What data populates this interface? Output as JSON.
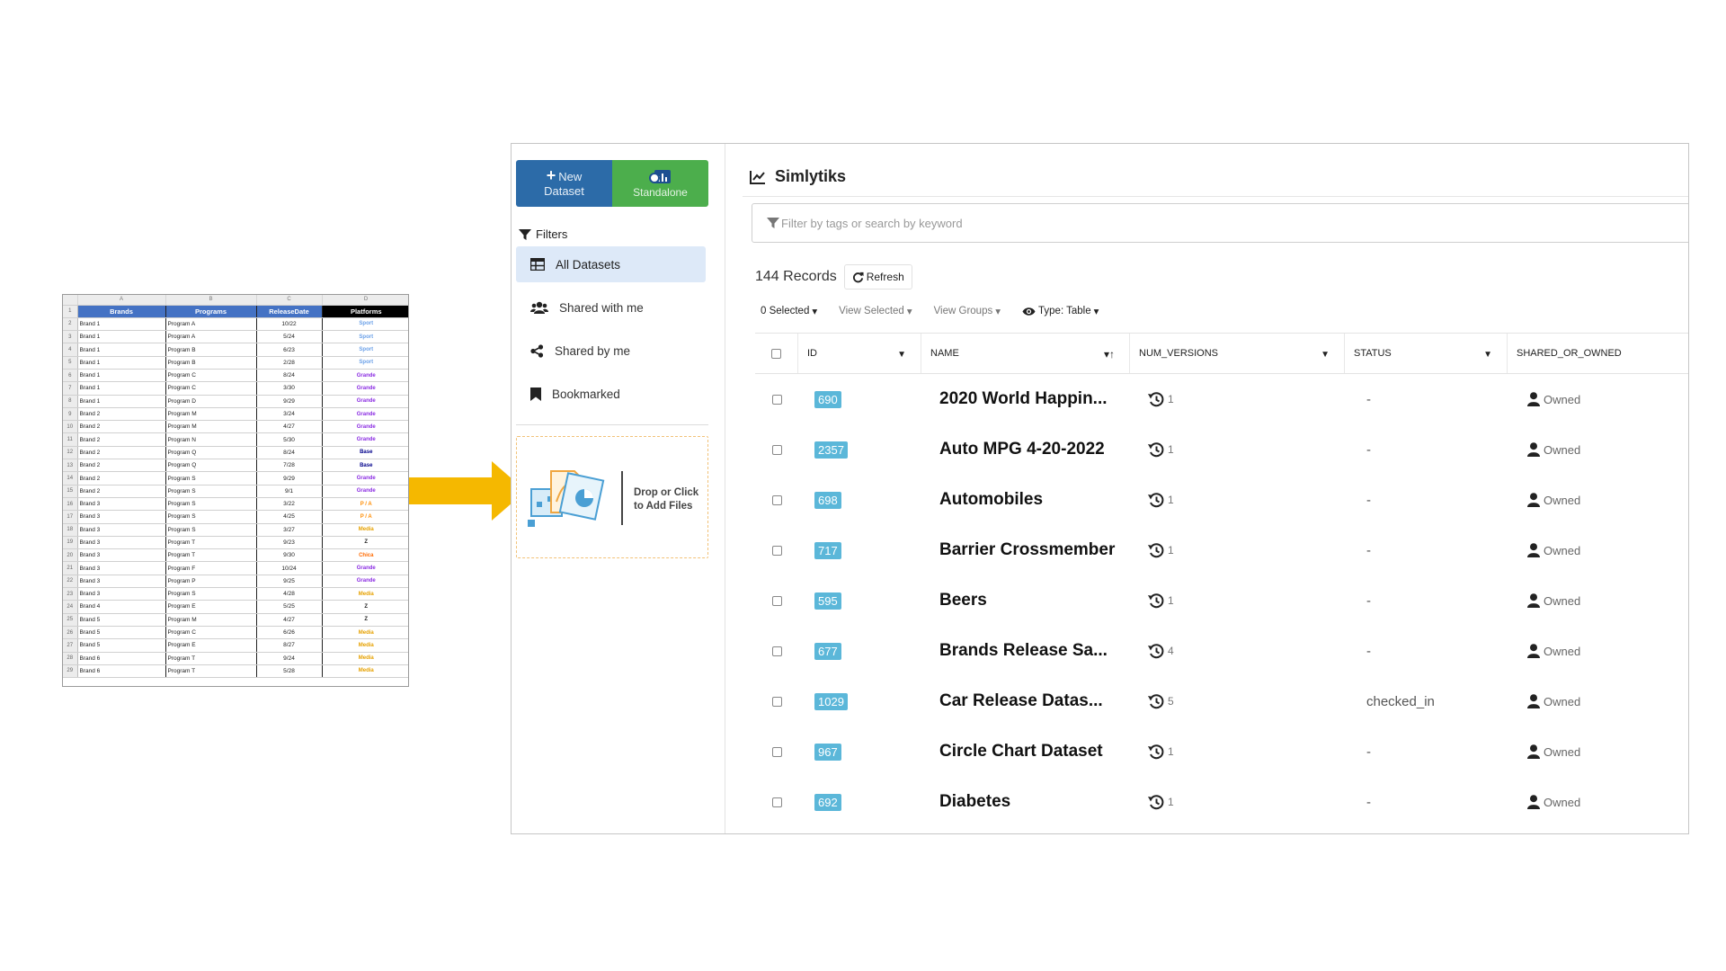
{
  "spreadsheet": {
    "column_letters": [
      "A",
      "B",
      "C",
      "D"
    ],
    "headers": [
      "Brands",
      "Programs",
      "ReleaseDate",
      "Platforms"
    ],
    "header_colors": [
      "#4472c4",
      "#4472c4",
      "#4472c4",
      "#000000"
    ],
    "rows": [
      [
        "Brand 1",
        "Program A",
        "10/22",
        "Sport",
        "#6aa0e8"
      ],
      [
        "Brand 1",
        "Program A",
        "5/24",
        "Sport",
        "#6aa0e8"
      ],
      [
        "Brand 1",
        "Program B",
        "6/23",
        "Sport",
        "#6aa0e8"
      ],
      [
        "Brand 1",
        "Program B",
        "2/28",
        "Sport",
        "#6aa0e8"
      ],
      [
        "Brand 1",
        "Program C",
        "8/24",
        "Grande",
        "#8a2be2"
      ],
      [
        "Brand 1",
        "Program C",
        "3/30",
        "Grande",
        "#8a2be2"
      ],
      [
        "Brand 1",
        "Program D",
        "9/29",
        "Grande",
        "#8a2be2"
      ],
      [
        "Brand 2",
        "Program M",
        "3/24",
        "Grande",
        "#8a2be2"
      ],
      [
        "Brand 2",
        "Program M",
        "4/27",
        "Grande",
        "#8a2be2"
      ],
      [
        "Brand 2",
        "Program N",
        "5/30",
        "Grande",
        "#8a2be2"
      ],
      [
        "Brand 2",
        "Program Q",
        "8/24",
        "Base",
        "#00008b"
      ],
      [
        "Brand 2",
        "Program Q",
        "7/28",
        "Base",
        "#00008b"
      ],
      [
        "Brand 2",
        "Program S",
        "9/29",
        "Grande",
        "#8a2be2"
      ],
      [
        "Brand 2",
        "Program S",
        "9/1",
        "Grande",
        "#8a2be2"
      ],
      [
        "Brand 3",
        "Program S",
        "3/22",
        "P / A",
        "#ff8c00"
      ],
      [
        "Brand 3",
        "Program S",
        "4/25",
        "P / A",
        "#ff8c00"
      ],
      [
        "Brand 3",
        "Program S",
        "3/27",
        "Media",
        "#e6a100"
      ],
      [
        "Brand 3",
        "Program T",
        "9/23",
        "Z",
        "#222222"
      ],
      [
        "Brand 3",
        "Program T",
        "9/30",
        "Chica",
        "#ff6a00"
      ],
      [
        "Brand 3",
        "Program F",
        "10/24",
        "Grande",
        "#8a2be2"
      ],
      [
        "Brand 3",
        "Program P",
        "9/25",
        "Grande",
        "#8a2be2"
      ],
      [
        "Brand 3",
        "Program S",
        "4/28",
        "Media",
        "#e6a100"
      ],
      [
        "Brand 4",
        "Program E",
        "5/25",
        "Z",
        "#222222"
      ],
      [
        "Brand 5",
        "Program M",
        "4/27",
        "Z",
        "#222222"
      ],
      [
        "Brand 5",
        "Program C",
        "6/26",
        "Media",
        "#e6a100"
      ],
      [
        "Brand 5",
        "Program E",
        "8/27",
        "Media",
        "#e6a100"
      ],
      [
        "Brand 6",
        "Program T",
        "9/24",
        "Media",
        "#e6a100"
      ],
      [
        "Brand 6",
        "Program T",
        "5/28",
        "Media",
        "#e6a100"
      ]
    ]
  },
  "arrow_color": "#f5b800",
  "sidebar": {
    "new_plus": "+",
    "new_label_1": "New",
    "new_label_2": "Dataset",
    "standalone_label": "Standalone",
    "filters_label": "Filters",
    "nav": [
      {
        "label": "All Datasets",
        "icon": "table-icon",
        "active": true
      },
      {
        "label": "Shared with me",
        "icon": "users-icon",
        "active": false
      },
      {
        "label": "Shared by me",
        "icon": "share-icon",
        "active": false
      },
      {
        "label": "Bookmarked",
        "icon": "bookmark-icon",
        "active": false
      }
    ],
    "dropzone_line1": "Drop or Click",
    "dropzone_line2": "to Add Files"
  },
  "main": {
    "title": "Simlytiks",
    "search_placeholder": "Filter by tags or search by keyword",
    "records_text": "144 Records",
    "refresh_label": "Refresh",
    "toolbar": {
      "selected": "0 Selected",
      "view_selected": "View Selected",
      "view_groups": "View Groups",
      "type": "Type: Table"
    },
    "columns": [
      "ID",
      "NAME",
      "NUM_VERSIONS",
      "STATUS",
      "SHARED_OR_OWNED"
    ],
    "sort_indicator": "▾↑",
    "rows": [
      {
        "id": "690",
        "name": "2020 World Happin...",
        "versions": "1",
        "status": "-",
        "shared": "Owned"
      },
      {
        "id": "2357",
        "name": "Auto MPG 4-20-2022",
        "versions": "1",
        "status": "-",
        "shared": "Owned"
      },
      {
        "id": "698",
        "name": "Automobiles",
        "versions": "1",
        "status": "-",
        "shared": "Owned"
      },
      {
        "id": "717",
        "name": "Barrier Crossmember",
        "versions": "1",
        "status": "-",
        "shared": "Owned"
      },
      {
        "id": "595",
        "name": "Beers",
        "versions": "1",
        "status": "-",
        "shared": "Owned"
      },
      {
        "id": "677",
        "name": "Brands Release Sa...",
        "versions": "4",
        "status": "-",
        "shared": "Owned"
      },
      {
        "id": "1029",
        "name": "Car Release Datas...",
        "versions": "5",
        "status": "checked_in",
        "shared": "Owned"
      },
      {
        "id": "967",
        "name": "Circle Chart Dataset",
        "versions": "1",
        "status": "-",
        "shared": "Owned"
      },
      {
        "id": "692",
        "name": "Diabetes",
        "versions": "1",
        "status": "-",
        "shared": "Owned"
      }
    ]
  }
}
